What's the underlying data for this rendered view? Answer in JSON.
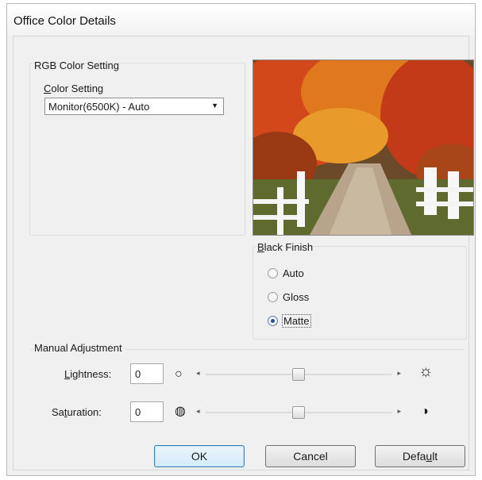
{
  "window": {
    "title": "Office Color Details"
  },
  "rgb_group": {
    "title": "RGB Color Setting",
    "color_setting_label": "Color Setting",
    "color_setting_value": "Monitor(6500K) - Auto"
  },
  "black_finish": {
    "title": "Black Finish",
    "options": [
      {
        "label": "Auto",
        "checked": false
      },
      {
        "label": "Gloss",
        "checked": false
      },
      {
        "label": "Matte",
        "checked": true
      }
    ]
  },
  "manual": {
    "title": "Manual Adjustment",
    "lightness": {
      "label": "Lightness:",
      "value": "0",
      "slider_fraction": 0.5
    },
    "saturation": {
      "label": "Saturation:",
      "value": "0",
      "slider_fraction": 0.5
    }
  },
  "buttons": {
    "ok": "OK",
    "cancel": "Cancel",
    "default": "Default"
  },
  "icons": {
    "lightness_low": "circle-outline-icon",
    "lightness_high": "sun-icon",
    "saturation_low": "gray-circle-icon",
    "saturation_high": "half-circle-icon"
  }
}
